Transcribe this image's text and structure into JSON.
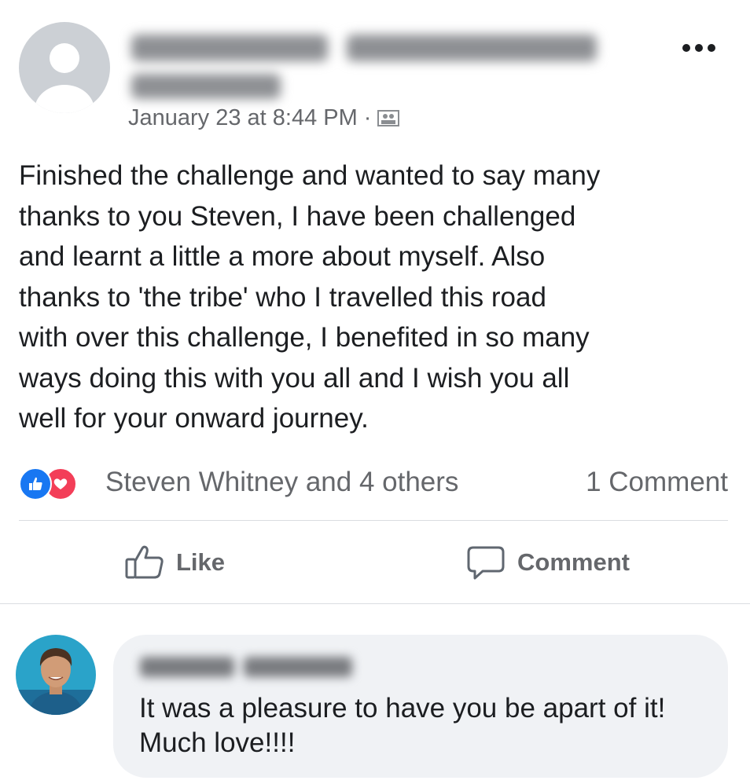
{
  "post": {
    "timestamp": "January 23 at 8:44 PM",
    "separator": "·",
    "audience_icon": "group-audience-icon",
    "more_icon": "more-options-icon",
    "text": "Finished the challenge and wanted to say many\nthanks to you Steven, I have been challenged\nand learnt a little a more about myself. Also\nthanks to 'the tribe' who I travelled this road\nwith over this challenge, I benefited in so many\nways doing this with you all and I wish you all\nwell for your onward journey."
  },
  "reactions": {
    "icons": [
      "like-reaction-icon",
      "love-reaction-icon"
    ],
    "summary": "Steven Whitney and 4 others",
    "comment_count": "1 Comment"
  },
  "actions": {
    "like_label": "Like",
    "comment_label": "Comment"
  },
  "comment": {
    "text": "It was a pleasure to have you be apart of it! Much love!!!!"
  },
  "colors": {
    "like_blue": "#1877f2",
    "love_red": "#f33e58",
    "secondary_text": "#65676b",
    "bubble_bg": "#f0f2f5"
  }
}
